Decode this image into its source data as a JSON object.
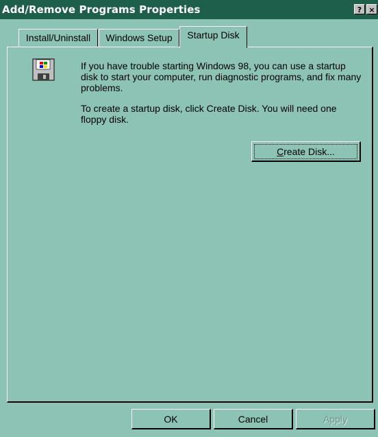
{
  "window": {
    "title": "Add/Remove Programs Properties",
    "help_button": "?",
    "close_button": "×"
  },
  "tabs": [
    {
      "label": "Install/Uninstall",
      "active": false
    },
    {
      "label": "Windows Setup",
      "active": false
    },
    {
      "label": "Startup Disk",
      "active": true
    }
  ],
  "content": {
    "icon": "startup-disk-icon",
    "paragraph1": "If you have trouble starting Windows 98, you can use a startup disk to start your computer, run diagnostic programs, and fix many problems.",
    "paragraph2": "To create a startup disk, click Create Disk. You will need one floppy disk.",
    "create_disk_label_accel": "C",
    "create_disk_label_rest": "reate Disk..."
  },
  "footer": {
    "ok_label": "OK",
    "cancel_label": "Cancel",
    "apply_label": "Apply"
  },
  "colors": {
    "background": "#8cc3b4",
    "titlebar": "#1e5f4b"
  }
}
